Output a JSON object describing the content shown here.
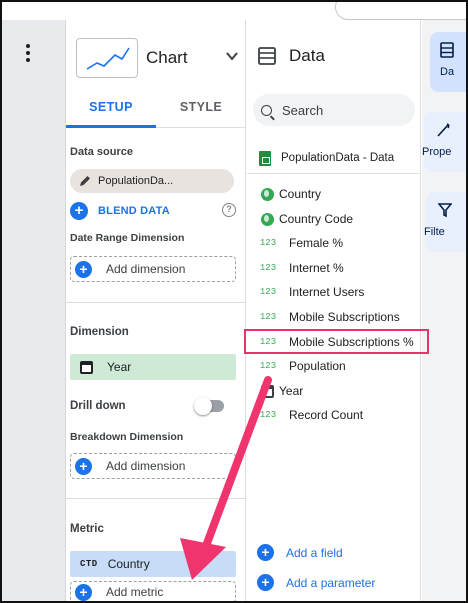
{
  "setup_panel": {
    "chart_label": "Chart",
    "tabs": {
      "setup": "SETUP",
      "style": "STYLE"
    },
    "data_source_title": "Data source",
    "data_source_chip": "PopulationDa...",
    "blend_data": "BLEND DATA",
    "date_range_title": "Date Range Dimension",
    "date_range_add": "Add dimension",
    "dimension_title": "Dimension",
    "dimension_chip": "Year",
    "drill_down": "Drill down",
    "breakdown_title": "Breakdown Dimension",
    "breakdown_add": "Add dimension",
    "metric_title": "Metric",
    "metric_chip_type": "CTD",
    "metric_chip": "Country",
    "metric_add": "Add metric"
  },
  "data_panel": {
    "title": "Data",
    "search_placeholder": "Search",
    "source_name": "PopulationData - Data",
    "fields": [
      {
        "type": "geo",
        "type_label": "",
        "label": "Country"
      },
      {
        "type": "geo",
        "type_label": "",
        "label": "Country Code"
      },
      {
        "type": "number",
        "type_label": "123",
        "label": "Female %"
      },
      {
        "type": "number",
        "type_label": "123",
        "label": "Internet %"
      },
      {
        "type": "number",
        "type_label": "123",
        "label": "Internet Users"
      },
      {
        "type": "number",
        "type_label": "123",
        "label": "Mobile Subscriptions"
      },
      {
        "type": "number",
        "type_label": "123",
        "label": "Mobile Subscriptions %"
      },
      {
        "type": "number",
        "type_label": "123",
        "label": "Population"
      },
      {
        "type": "date",
        "type_label": "",
        "label": "Year"
      },
      {
        "type": "number",
        "type_label": "123",
        "label": "Record Count"
      }
    ],
    "highlighted_field": "Mobile Subscriptions %",
    "add_field": "Add a field",
    "add_parameter": "Add a parameter"
  },
  "right_rail": {
    "tiles": [
      {
        "label": "Da",
        "icon": "data-icon"
      },
      {
        "label": "Prope",
        "icon": "properties-icon"
      },
      {
        "label": "Filte",
        "icon": "filter-icon"
      }
    ]
  },
  "colors": {
    "accent": "#1a73e8",
    "highlight_box": "#e8336a",
    "arrow": "#f0346e",
    "dimension_chip": "#ceead6",
    "metric_chip": "#c6dcf7"
  }
}
